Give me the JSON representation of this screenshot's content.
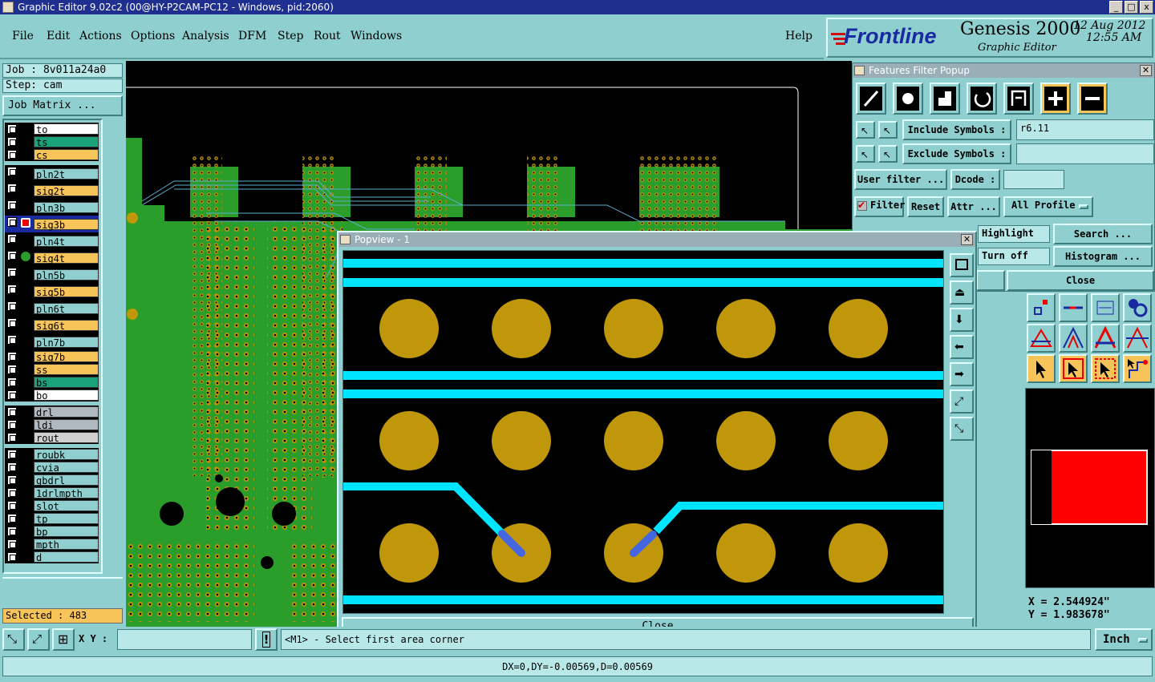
{
  "window": {
    "title": "Graphic Editor 9.02c2 (00@HY-P2CAM-PC12 - Windows, pid:2060)",
    "min": "_",
    "max": "□",
    "close": "x"
  },
  "menu": {
    "file": "File",
    "edit": "Edit",
    "actions": "Actions",
    "options": "Options",
    "analysis": "Analysis",
    "dfm": "DFM",
    "step": "Step",
    "rout": "Rout",
    "windows": "Windows",
    "help": "Help"
  },
  "brand": {
    "logo": "Frontline",
    "product": "Genesis 2000",
    "subtitle": "Graphic Editor",
    "date": "12 Aug 2012",
    "time": "12:55 AM"
  },
  "job": {
    "job_label": "Job : 8v011a24a0",
    "step_label": "Step: cam",
    "matrix_button": "Job Matrix ..."
  },
  "layers": [
    {
      "name": "to",
      "color": "#ffffff",
      "group": 0
    },
    {
      "name": "ts",
      "color": "#1aa37a",
      "group": 0
    },
    {
      "name": "cs",
      "color": "#f7c45a",
      "group": 0
    },
    {
      "name": "pln2t",
      "color": "#8fcfcf",
      "group": 1
    },
    {
      "name": "sig2t",
      "color": "#f7c45a",
      "group": 1
    },
    {
      "name": "pln3b",
      "color": "#8fcfcf",
      "group": 1
    },
    {
      "name": "sig3b",
      "color": "#f7c45a",
      "group": 1
    },
    {
      "name": "pln4t",
      "color": "#8fcfcf",
      "group": 1
    },
    {
      "name": "sig4t",
      "color": "#f7c45a",
      "group": 1
    },
    {
      "name": "pln5b",
      "color": "#8fcfcf",
      "group": 1
    },
    {
      "name": "sig5b",
      "color": "#f7c45a",
      "group": 1
    },
    {
      "name": "pln6t",
      "color": "#8fcfcf",
      "group": 1
    },
    {
      "name": "sig6t",
      "color": "#f7c45a",
      "group": 1
    },
    {
      "name": "pln7b",
      "color": "#8fcfcf",
      "group": 1
    },
    {
      "name": "sig7b",
      "color": "#f7c45a",
      "group": 2
    },
    {
      "name": "ss",
      "color": "#f7c45a",
      "group": 2
    },
    {
      "name": "bs",
      "color": "#1aa37a",
      "group": 2
    },
    {
      "name": "bo",
      "color": "#ffffff",
      "group": 2
    },
    {
      "name": "drl",
      "color": "#b0b8c0",
      "group": 3
    },
    {
      "name": "ldi",
      "color": "#b0b8c0",
      "group": 3
    },
    {
      "name": "rout",
      "color": "#d0d0d0",
      "group": 3
    },
    {
      "name": "roubk",
      "color": "#8fcfcf",
      "group": 4
    },
    {
      "name": "cvia",
      "color": "#8fcfcf",
      "group": 4
    },
    {
      "name": "gbdrl",
      "color": "#8fcfcf",
      "group": 4
    },
    {
      "name": "1drlmpth",
      "color": "#8fcfcf",
      "group": 4
    },
    {
      "name": "slot",
      "color": "#8fcfcf",
      "group": 4
    },
    {
      "name": "tp",
      "color": "#8fcfcf",
      "group": 4
    },
    {
      "name": "bp",
      "color": "#8fcfcf",
      "group": 4
    },
    {
      "name": "mpth",
      "color": "#8fcfcf",
      "group": 4
    },
    {
      "name": "d",
      "color": "#8fcfcf",
      "group": 4
    }
  ],
  "selected": "Selected : 483",
  "filter": {
    "title": "Features Filter Popup",
    "include_label": "Include Symbols :",
    "include_value": "r6.11",
    "exclude_label": "Exclude Symbols :",
    "exclude_value": "",
    "user_filter": "User filter ...",
    "dcode_label": "Dcode :",
    "dcode_value": "",
    "filter_label": "Filter",
    "reset": "Reset",
    "attr": "Attr ...",
    "all_profile": "All Profile",
    "highlight": "Highlight",
    "search": "Search ...",
    "turn_off": "Turn off",
    "histogram": "Histogram ...",
    "close": "Close"
  },
  "popview": {
    "title": "Popview - 1",
    "close": "Close"
  },
  "coords": {
    "x": "X = 2.544924\"",
    "y": "Y = 1.983678\""
  },
  "bottom": {
    "xy_label": "X Y :",
    "xy_value": "",
    "prompt": "<M1> - Select first area corner",
    "unit": "Inch"
  },
  "status": "DX=0,DY=-0.00569,D=0.00569",
  "colors": {
    "board": "#2a9d2a",
    "pad": "#c0960a",
    "trace": "#00e5ff",
    "teal": "#8fcfcf",
    "orange": "#f7c45a"
  }
}
